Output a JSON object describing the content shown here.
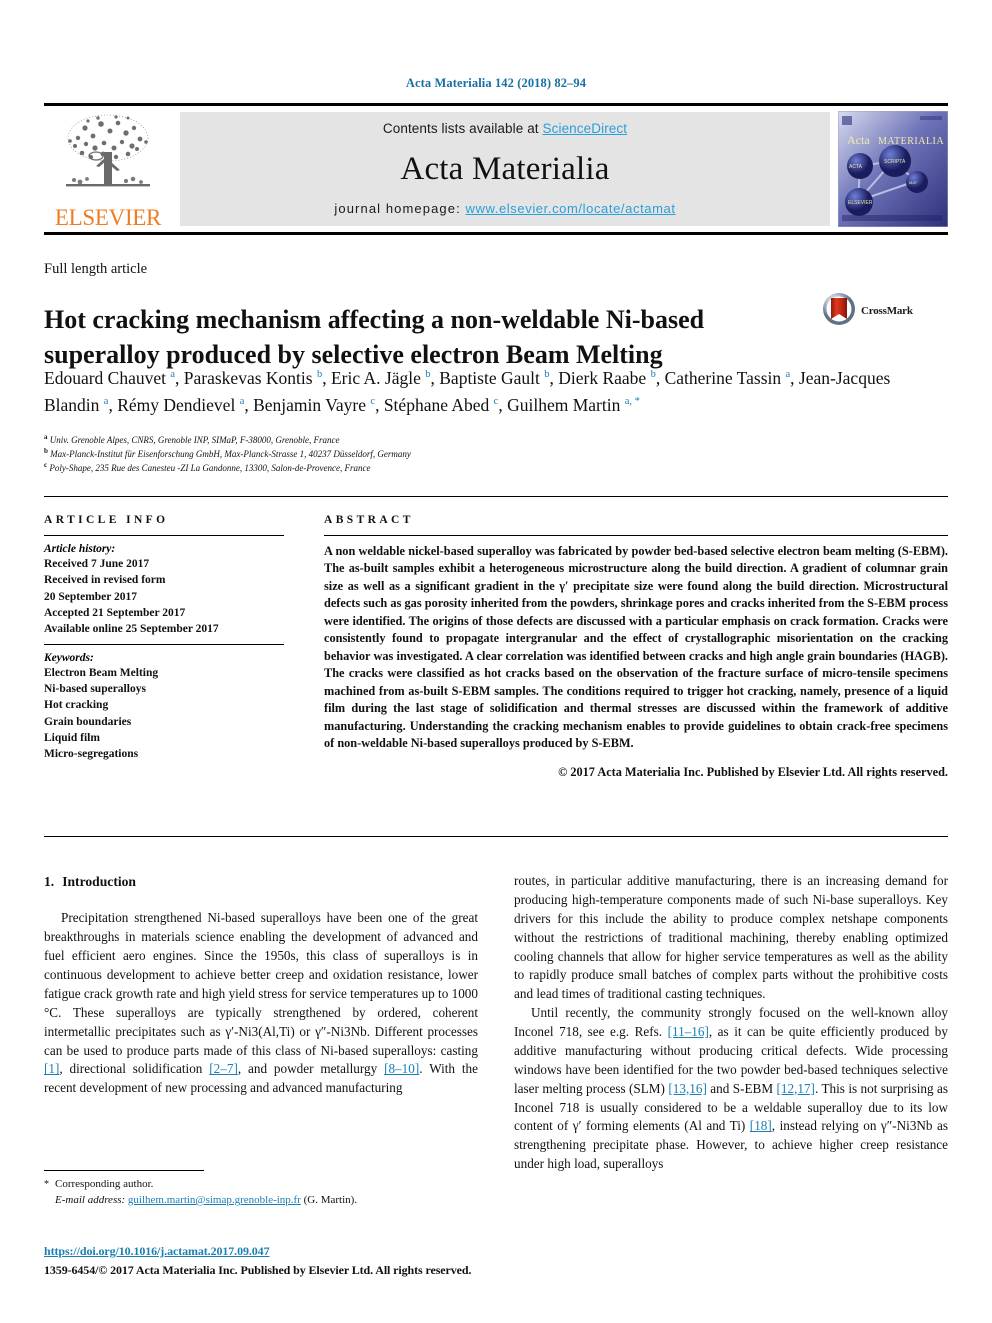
{
  "running_head": "Acta Materialia 142 (2018) 82–94",
  "masthead": {
    "contents_prefix": "Contents lists available at ",
    "sciencedirect": "ScienceDirect",
    "journal_name": "Acta Materialia",
    "homepage_label": "journal homepage: ",
    "homepage_url": "www.elsevier.com/locate/actamat",
    "publisher_wordmark": "ELSEVIER",
    "publisher_logo_icon": "elsevier-tree-icon",
    "cover_thumb_title": "Acta MATERIALIA",
    "accent_orange": "#ef7c22",
    "link_blue": "#2a9fd8"
  },
  "article_type": "Full length article",
  "title": "Hot cracking mechanism affecting a non-weldable Ni-based superalloy produced by selective electron Beam Melting",
  "crossmark": {
    "label": "CrossMark",
    "icon": "crossmark-icon"
  },
  "authors": [
    {
      "name": "Edouard Chauvet",
      "marks": "a",
      "sep": ", "
    },
    {
      "name": "Paraskevas Kontis",
      "marks": "b",
      "sep": ", "
    },
    {
      "name": "Eric A. Jägle",
      "marks": "b",
      "sep": ", "
    },
    {
      "name": "Baptiste Gault",
      "marks": "b",
      "sep": ", "
    },
    {
      "name": "Dierk Raabe",
      "marks": "b",
      "sep": ", "
    },
    {
      "name": "Catherine Tassin",
      "marks": "a",
      "sep": ", "
    },
    {
      "name": "Jean-Jacques Blandin",
      "marks": "a",
      "sep": ", "
    },
    {
      "name": "Rémy Dendievel",
      "marks": "a",
      "sep": ", "
    },
    {
      "name": "Benjamin Vayre",
      "marks": "c",
      "sep": ", "
    },
    {
      "name": "Stéphane Abed",
      "marks": "c",
      "sep": ", "
    },
    {
      "name": "Guilhem Martin",
      "marks": "a, *",
      "sep": ""
    }
  ],
  "affiliations": [
    {
      "mark": "a",
      "text": "Univ. Grenoble Alpes, CNRS, Grenoble INP, SIMaP, F-38000, Grenoble, France"
    },
    {
      "mark": "b",
      "text": "Max-Planck-Institut für Eisenforschung GmbH, Max-Planck-Strasse 1, 40237 Düsseldorf, Germany"
    },
    {
      "mark": "c",
      "text": "Poly-Shape, 235 Rue des Canesteu -ZI La Gandonne, 13300, Salon-de-Provence, France"
    }
  ],
  "article_info": {
    "heading": "ARTICLE INFO",
    "history_label": "Article history:",
    "history": [
      "Received 7 June 2017",
      "Received in revised form",
      "20 September 2017",
      "Accepted 21 September 2017",
      "Available online 25 September 2017"
    ],
    "keywords_label": "Keywords:",
    "keywords": [
      "Electron Beam Melting",
      "Ni-based superalloys",
      "Hot cracking",
      "Grain boundaries",
      "Liquid film",
      "Micro-segregations"
    ]
  },
  "abstract": {
    "heading": "ABSTRACT",
    "text": "A non weldable nickel-based superalloy was fabricated by powder bed-based selective electron beam melting (S-EBM). The as-built samples exhibit a heterogeneous microstructure along the build direction. A gradient of columnar grain size as well as a significant gradient in the γ′ precipitate size were found along the build direction. Microstructural defects such as gas porosity inherited from the powders, shrinkage pores and cracks inherited from the S-EBM process were identified. The origins of those defects are discussed with a particular emphasis on crack formation. Cracks were consistently found to propagate intergranular and the effect of crystallographic misorientation on the cracking behavior was investigated. A clear correlation was identified between cracks and high angle grain boundaries (HAGB). The cracks were classified as hot cracks based on the observation of the fracture surface of micro-tensile specimens machined from as-built S-EBM samples. The conditions required to trigger hot cracking, namely, presence of a liquid film during the last stage of solidification and thermal stresses are discussed within the framework of additive manufacturing. Understanding the cracking mechanism enables to provide guidelines to obtain crack-free specimens of non-weldable Ni-based superalloys produced by S-EBM.",
    "copyright": "© 2017 Acta Materialia Inc. Published by Elsevier Ltd. All rights reserved."
  },
  "introduction": {
    "number": "1.",
    "heading": "Introduction",
    "left_paragraph_part1": "Precipitation strengthened Ni-based superalloys have been one of the great breakthroughs in materials science enabling the development of advanced and fuel efficient aero engines. Since the 1950s, this class of superalloys is in continuous development to achieve better creep and oxidation resistance, lower fatigue crack growth rate and high yield stress for service temperatures up to 1000 °C. These superalloys are typically strengthened by ordered, coherent intermetallic precipitates such as γ′-Ni3(Al,Ti) or γ″-Ni3Nb. Different processes can be used to produce parts made of this class of Ni-based superalloys: casting ",
    "ref_casting": "[1]",
    "left_paragraph_part2": ", directional solidification ",
    "ref_dirsol": "[2–7]",
    "left_paragraph_part3": ", and powder metallurgy ",
    "ref_pm": "[8–10]",
    "left_paragraph_part4": ". With the recent development of new processing and advanced manufacturing",
    "right_paragraph1": "routes, in particular additive manufacturing, there is an increasing demand for producing high-temperature components made of such Ni-base superalloys. Key drivers for this include the ability to produce complex netshape components without the restrictions of traditional machining, thereby enabling optimized cooling channels that allow for higher service temperatures as well as the ability to rapidly produce small batches of complex parts without the prohibitive costs and lead times of traditional casting techniques.",
    "right_p2_part1": "Until recently, the community strongly focused on the well-known alloy Inconel 718, see e.g. Refs. ",
    "ref_inconel": "[11–16]",
    "right_p2_part2": ", as it can be quite efficiently produced by additive manufacturing without producing critical defects. Wide processing windows have been identified for the two powder bed-based techniques selective laser melting process (SLM) ",
    "ref_slm": "[13,16]",
    "right_p2_part3": " and S-EBM ",
    "ref_sebm": "[12,17]",
    "right_p2_part4": ". This is not surprising as Inconel 718 is usually considered to be a weldable superalloy due to its low content of γ′ forming elements (Al and Ti) ",
    "ref_gamma": "[18]",
    "right_p2_part5": ", instead relying on γ″-Ni3Nb as strengthening precipitate phase. However, to achieve higher creep resistance under high load, superalloys"
  },
  "footer": {
    "corresponding_star": "*",
    "corresponding_label": "Corresponding author.",
    "email_label": "E-mail address:",
    "email": "guilhem.martin@simap.grenoble-inp.fr",
    "email_owner": "(G. Martin).",
    "doi": "https://doi.org/10.1016/j.actamat.2017.09.047",
    "issn_line": "1359-6454/© 2017 Acta Materialia Inc. Published by Elsevier Ltd. All rights reserved."
  }
}
